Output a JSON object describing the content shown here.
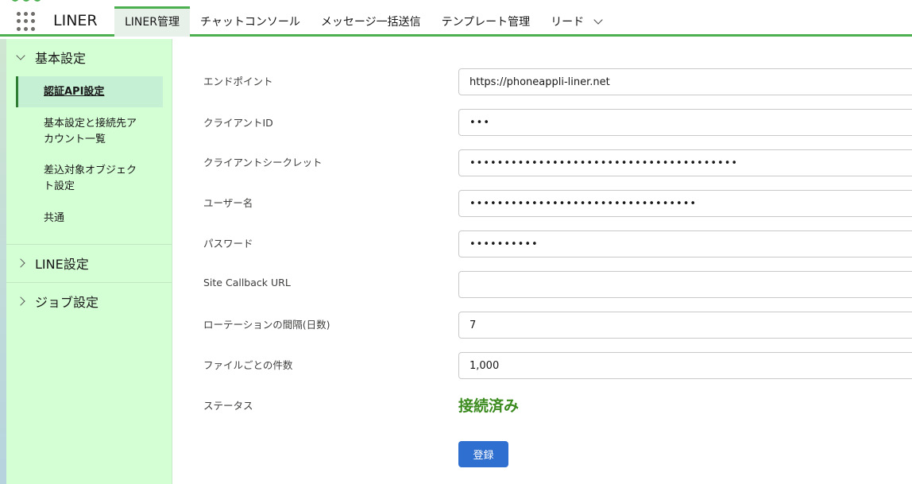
{
  "app": {
    "name": "LINER"
  },
  "nav": {
    "tabs": [
      {
        "label": "LINER管理"
      },
      {
        "label": "チャットコンソール"
      },
      {
        "label": "メッセージ一括送信"
      },
      {
        "label": "テンプレート管理"
      },
      {
        "label": "リード"
      }
    ]
  },
  "sidebar": {
    "sections": [
      {
        "label": "基本設定"
      },
      {
        "label": "LINE設定"
      },
      {
        "label": "ジョブ設定"
      }
    ],
    "items": [
      {
        "label": "認証API設定"
      },
      {
        "label": "基本設定と接続先ア"
      },
      {
        "label": "カウント一覧"
      },
      {
        "label": "差込対象オブジェク"
      },
      {
        "label": "ト設定"
      },
      {
        "label": "共通"
      }
    ]
  },
  "form": {
    "fields": [
      {
        "label": "エンドポイント",
        "value": "https://phoneappli-liner.net"
      },
      {
        "label": "クライアントID",
        "value": "•••"
      },
      {
        "label": "クライアントシークレット",
        "value": "•••••••••••••••••••••••••••••••••••••••"
      },
      {
        "label": "ユーザー名",
        "value": "•••••••••••••••••••••••••••••••••"
      },
      {
        "label": "パスワード",
        "value": "••••••••••"
      },
      {
        "label": "Site Callback URL",
        "value": ""
      },
      {
        "label": "ローテーションの間隔(日数)",
        "value": "7"
      },
      {
        "label": "ファイルごとの件数",
        "value": "1,000"
      }
    ],
    "status_label": "ステータス",
    "status_value": "接続済み",
    "submit_label": "登録"
  },
  "colors": {
    "accent": "#4caf50",
    "sidebar_bg": "#d4ffd4",
    "status": "#3a8a1e",
    "button": "#2f6fcf"
  }
}
